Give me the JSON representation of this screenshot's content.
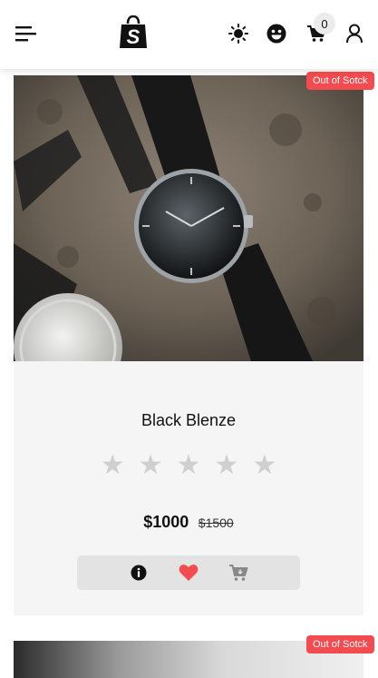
{
  "header": {
    "cart_count": "0",
    "icons": [
      "menu-icon",
      "shopify-bag-icon",
      "sun-icon",
      "smiley-icon",
      "cart-icon",
      "user-icon"
    ]
  },
  "products": [
    {
      "badge": "Out of Sotck",
      "title": "Black Blenze",
      "rating": 0,
      "stars": [
        "★",
        "★",
        "★",
        "★",
        "★"
      ],
      "price": "$1000",
      "old_price": "$1500",
      "actions": [
        "info-icon",
        "heart-icon",
        "add-to-cart-icon"
      ]
    },
    {
      "badge": "Out of Sotck"
    }
  ],
  "colors": {
    "badge": "#f34b4f",
    "heart": "#f34b4f",
    "card_bg": "#f5f5f5",
    "actions_bg": "#e3e3e3",
    "star_empty": "#cfcfcf"
  }
}
